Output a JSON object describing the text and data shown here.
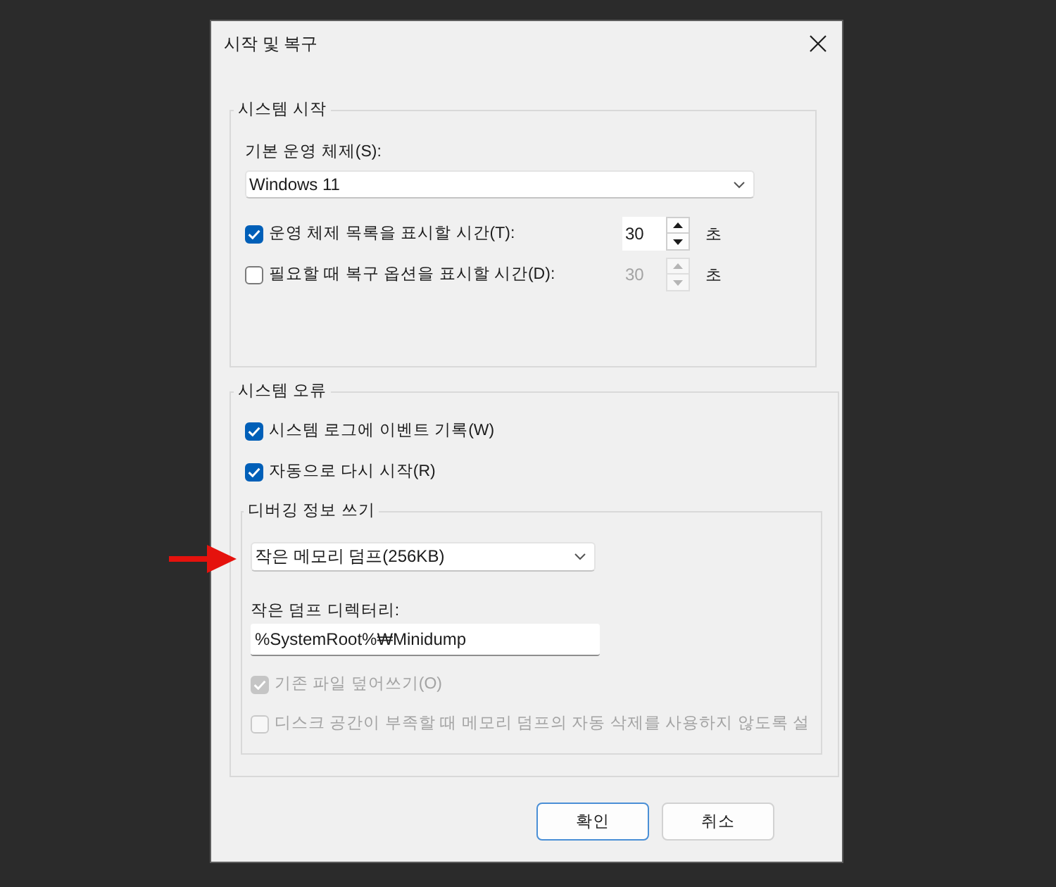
{
  "window": {
    "title": "시작 및 복구"
  },
  "system_startup": {
    "legend": "시스템 시작",
    "default_os_label": "기본 운영 체제(S):",
    "default_os": {
      "value": "Windows 11"
    },
    "timeouts": [
      {
        "label": "운영 체제 목록을 표시할 시간(T):",
        "checked": true,
        "value": "30",
        "disabled": false,
        "unit": "초"
      },
      {
        "label": "필요할 때 복구 옵션을 표시할 시간(D):",
        "checked": false,
        "value": "30",
        "disabled": true,
        "unit": "초"
      }
    ]
  },
  "system_failure": {
    "legend": "시스템 오류",
    "options": [
      {
        "label": "시스템 로그에 이벤트 기록(W)",
        "checked": true,
        "disabled": false
      },
      {
        "label": "자동으로 다시 시작(R)",
        "checked": true,
        "disabled": false
      }
    ],
    "debug_info": {
      "legend": "디버깅 정보 쓰기",
      "dump_type": {
        "value": "작은 메모리 덤프(256KB)"
      },
      "dump_dir_label": "작은 덤프 디렉터리:",
      "dump_dir": {
        "value": "%SystemRoot%₩Minidump"
      },
      "options": [
        {
          "label": "기존 파일 덮어쓰기(O)",
          "checked": true,
          "disabled": true
        },
        {
          "label": "디스크 공간이 부족할 때 메모리 덤프의 자동 삭제를 사용하지 않도록 설",
          "checked": false,
          "disabled": true
        }
      ]
    }
  },
  "buttons": [
    {
      "label": "확인",
      "default": true
    },
    {
      "label": "취소",
      "default": false
    }
  ],
  "annotations": [
    {
      "kind": "arrow"
    }
  ]
}
